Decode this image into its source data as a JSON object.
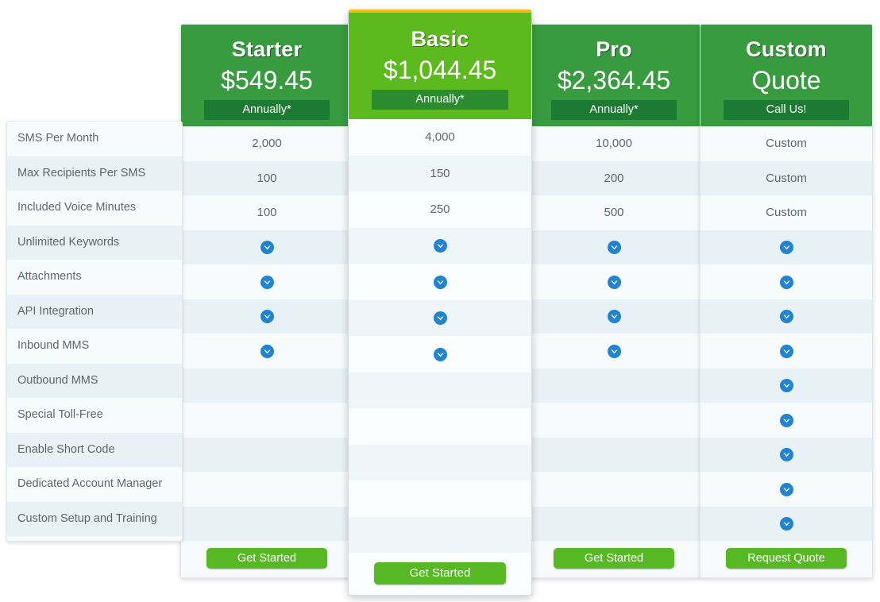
{
  "colors": {
    "plan_header_green": "#389b40",
    "featured_header_green": "#5cb91e",
    "featured_top_border": "#f5b91b",
    "badge_green": "#1d7a33",
    "cta_green": "#56b822",
    "check_blue": "#2283d1",
    "row_light": "#f7fbfc",
    "row_dark": "#e8f1f5",
    "label_text": "#5b6770"
  },
  "features": [
    "SMS Per Month",
    "Max Recipients Per SMS",
    "Included Voice Minutes",
    "Unlimited Keywords",
    "Attachments",
    "API Integration",
    "Inbound MMS",
    "Outbound MMS",
    "Special Toll-Free",
    "Enable Short Code",
    "Dedicated Account Manager",
    "Custom Setup and Training"
  ],
  "plans": [
    {
      "id": "starter",
      "name": "Starter",
      "price": "$549.45",
      "period": "Annually*",
      "featured": false,
      "values": [
        "2,000",
        "100",
        "100",
        "check",
        "check",
        "check",
        "check",
        "",
        "",
        "",
        "",
        ""
      ],
      "cta": "Get Started"
    },
    {
      "id": "basic",
      "name": "Basic",
      "price": "$1,044.45",
      "period": "Annually*",
      "featured": true,
      "values": [
        "4,000",
        "150",
        "250",
        "check",
        "check",
        "check",
        "check",
        "",
        "",
        "",
        "",
        ""
      ],
      "cta": "Get Started"
    },
    {
      "id": "pro",
      "name": "Pro",
      "price": "$2,364.45",
      "period": "Annually*",
      "featured": false,
      "values": [
        "10,000",
        "200",
        "500",
        "check",
        "check",
        "check",
        "check",
        "",
        "",
        "",
        "",
        ""
      ],
      "cta": "Get Started"
    },
    {
      "id": "custom",
      "name": "Custom",
      "price": "Quote",
      "period": "Call Us!",
      "featured": false,
      "values": [
        "Custom",
        "Custom",
        "Custom",
        "check",
        "check",
        "check",
        "check",
        "check",
        "check",
        "check",
        "check",
        "check"
      ],
      "cta": "Request Quote"
    }
  ],
  "icons": {
    "check": "check-circle-icon"
  }
}
